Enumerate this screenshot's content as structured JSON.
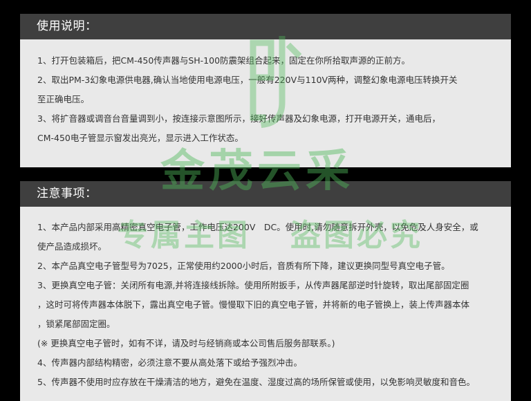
{
  "usage": {
    "title": "使用说明：",
    "lines": [
      "1、打开包装箱后，把CM-450传声器与SH-100防震架组合起来，固定在你所拾取声源的正前方。",
      "2、取出PM-3幻象电源供电器,确认当地使用电源电压，一般有220V与110V两种，调整幻象电源电压转换开关",
      "至正确电压。",
      "3、将扩音器或调音台音量调到小，按连接示意图所示，接好传声器及幻象电源，打开电源开关，通电后，",
      "CM-450电子管显示窗发出亮光，显示进入工作状态。"
    ]
  },
  "notes": {
    "title": "注意事项：",
    "lines": [
      "1、本产品内部采用高精密真空电子管，工作电压达200V　DC。使用时,请勿随意拆开外壳，以免危及人身安全，或",
      "使产品造成损坏。",
      "2、本产品真空电子管型号为7025，正常使用约2000小时后，音质有所下降，建议更换同型号真空电子管。",
      "3、更换真空电子管：关闭所有电源,并将连接线拆除。使用所附扳手，从传声器尾部逆时针旋转，取出尾部固定圈",
      "，这时可将传声器本体脱下，露出真空电子管。慢慢取下旧的真空电子管，并将新的电子管换上，装上传声器本体",
      "，锁紧尾部固定圈。",
      "(※ 更换真空电子管时，如有不详，请及时与经销商或本公司售后服务部联系。)",
      "4、传声器内部结构精密，必须注意不要从高处落下或给予强烈冲击。",
      "5、传声器不使用时应存放在干燥清洁的地方，避免在温度、湿度过高的场所保管或使用，以免影响灵敏度和音色。"
    ]
  },
  "watermark": {
    "brand": "金茂云采",
    "line2_left": "专属主图",
    "line2_right": "盗图必究"
  },
  "colors": {
    "background": "#000000",
    "panel": "#e9e9e9",
    "header": "#3f3f3f",
    "text": "#333333",
    "watermark": "#50b95a"
  }
}
